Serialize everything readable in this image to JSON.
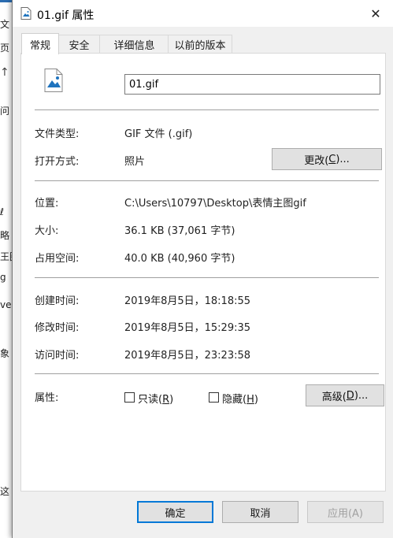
{
  "background": {
    "fragments": [
      "文",
      "页",
      "问",
      "ℓ",
      "略",
      "王图",
      "g",
      "ve",
      "象",
      "这"
    ]
  },
  "dialog": {
    "title": "01.gif 属性",
    "tabs": [
      {
        "label": "常规",
        "active": true
      },
      {
        "label": "安全",
        "active": false
      },
      {
        "label": "详细信息",
        "active": false
      },
      {
        "label": "以前的版本",
        "active": false
      }
    ],
    "file_name": "01.gif",
    "file_type": {
      "label": "文件类型:",
      "value": "GIF 文件 (.gif)"
    },
    "opens_with": {
      "label": "打开方式:",
      "value": "照片",
      "button_text": "更改(",
      "button_key": "C",
      "button_suffix": ")..."
    },
    "location": {
      "label": "位置:",
      "value": "C:\\Users\\10797\\Desktop\\表情主图gif"
    },
    "size": {
      "label": "大小:",
      "value": "36.1 KB (37,061 字节)"
    },
    "size_on_disk": {
      "label": "占用空间:",
      "value": "40.0 KB (40,960 字节)"
    },
    "created": {
      "label": "创建时间:",
      "value": "2019年8月5日，18:18:55"
    },
    "modified": {
      "label": "修改时间:",
      "value": "2019年8月5日，15:29:35"
    },
    "accessed": {
      "label": "访问时间:",
      "value": "2019年8月5日，23:23:58"
    },
    "attributes": {
      "label": "属性:",
      "readonly_text": "只读(",
      "readonly_key": "R",
      "readonly_suffix": ")",
      "readonly_checked": false,
      "hidden_text": "隐藏(",
      "hidden_key": "H",
      "hidden_suffix": ")",
      "hidden_checked": false,
      "advanced_text": "高级(",
      "advanced_key": "D",
      "advanced_suffix": ")..."
    },
    "footer": {
      "ok": "确定",
      "cancel": "取消",
      "apply": "应用(A)"
    }
  },
  "colors": {
    "accent": "#0078d7",
    "dialog_bg": "#f0f0f0",
    "panel_bg": "#ffffff"
  }
}
